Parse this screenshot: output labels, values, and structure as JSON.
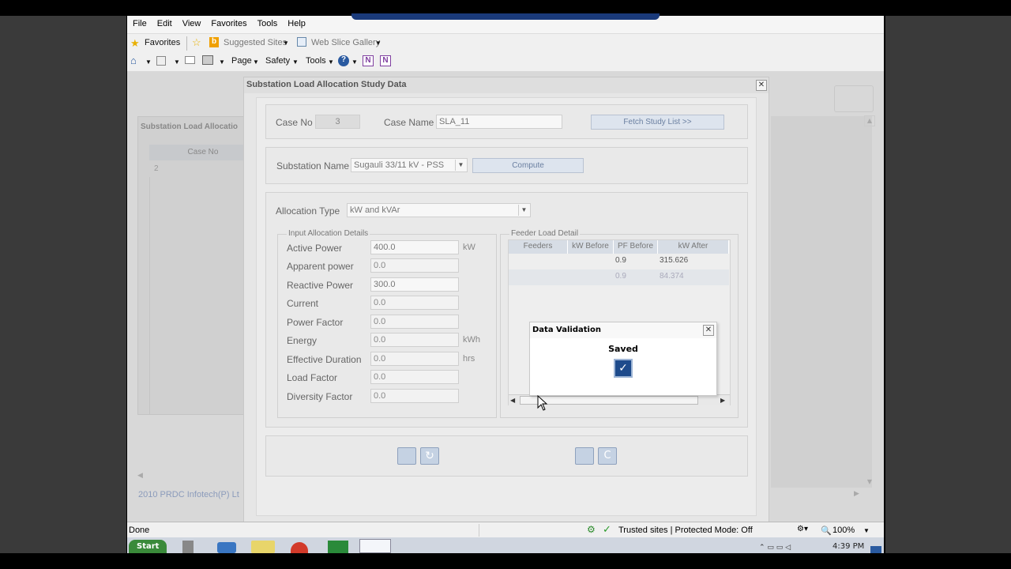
{
  "menu": [
    "File",
    "Edit",
    "View",
    "Favorites",
    "Tools",
    "Help"
  ],
  "favorites_bar": {
    "favorites": "Favorites",
    "suggested_sites": "Suggested Sites",
    "web_slice_gallery": "Web Slice Gallery"
  },
  "command_bar": {
    "page": "Page",
    "safety": "Safety",
    "tools": "Tools"
  },
  "background_app": {
    "title": "Substation Load Allocatio",
    "column_header": "Case No",
    "row_value": "2",
    "footer": "2010 PRDC Infotech(P) Lt"
  },
  "dialog": {
    "title": "Substation Load Allocation Study Data",
    "case_no_label": "Case No",
    "case_no_value": "3",
    "case_name_label": "Case Name",
    "case_name_value": "SLA_11",
    "fetch_button": "Fetch Study List >>",
    "substation_label": "Substation Name",
    "substation_value": "Sugauli 33/11 kV - PSS",
    "compute_button": "Compute",
    "allocation_type_label": "Allocation Type",
    "allocation_type_value": "kW and kVAr",
    "input_legend": "Input Allocation Details",
    "feeder_legend": "Feeder Load Detail",
    "inputs": [
      {
        "label": "Active Power",
        "value": "400.0",
        "unit": "kW"
      },
      {
        "label": "Apparent power",
        "value": "0.0",
        "unit": ""
      },
      {
        "label": "Reactive Power",
        "value": "300.0",
        "unit": ""
      },
      {
        "label": "Current",
        "value": "0.0",
        "unit": ""
      },
      {
        "label": "Power Factor",
        "value": "0.0",
        "unit": ""
      },
      {
        "label": "Energy",
        "value": "0.0",
        "unit": "kWh"
      },
      {
        "label": "Effective Duration",
        "value": "0.0",
        "unit": "hrs"
      },
      {
        "label": "Load Factor",
        "value": "0.0",
        "unit": ""
      },
      {
        "label": "Diversity Factor",
        "value": "0.0",
        "unit": ""
      }
    ],
    "table": {
      "headers": [
        "Feeders",
        "kW Before",
        "PF Before",
        "kW After"
      ],
      "rows": [
        [
          "",
          "",
          "0.9",
          "315.626"
        ],
        [
          "",
          "",
          "0.9",
          "84.374"
        ]
      ]
    }
  },
  "popup": {
    "title": "Data Validation",
    "message": "Saved"
  },
  "status_bar": {
    "left": "Done",
    "zone": "Trusted sites | Protected Mode: Off",
    "zoom": "100%"
  },
  "taskbar": {
    "start": "Start",
    "time": "4:39 PM"
  }
}
